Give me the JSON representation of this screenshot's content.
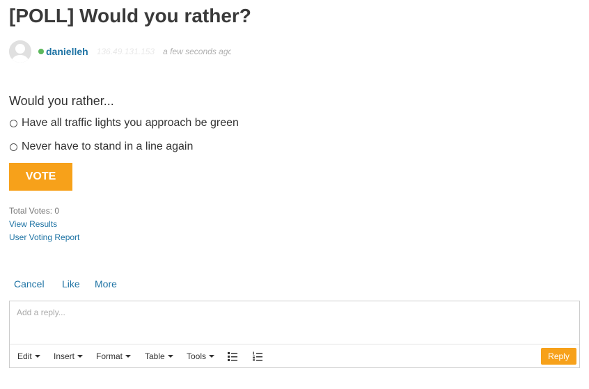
{
  "post": {
    "title": "[POLL] Would you rather?",
    "author": "danielleh",
    "ip": "136.49.131.153",
    "timestamp": "a few seconds ago"
  },
  "poll": {
    "question": "Would you rather...",
    "options": [
      "Have all traffic lights you approach be green",
      "Never have to stand in a line again"
    ],
    "vote_label": "VOTE",
    "total_votes": "Total Votes: 0",
    "view_results": "View Results",
    "voting_report": "User Voting Report"
  },
  "actions": {
    "cancel": "Cancel",
    "like": "Like",
    "more": "More"
  },
  "editor": {
    "placeholder": "Add a reply...",
    "toolbar": {
      "edit": "Edit",
      "insert": "Insert",
      "format": "Format",
      "table": "Table",
      "tools": "Tools"
    },
    "reply_label": "Reply"
  },
  "colors": {
    "accent": "#f7a11a",
    "link": "#1e73a4",
    "online": "#5cb85c"
  }
}
